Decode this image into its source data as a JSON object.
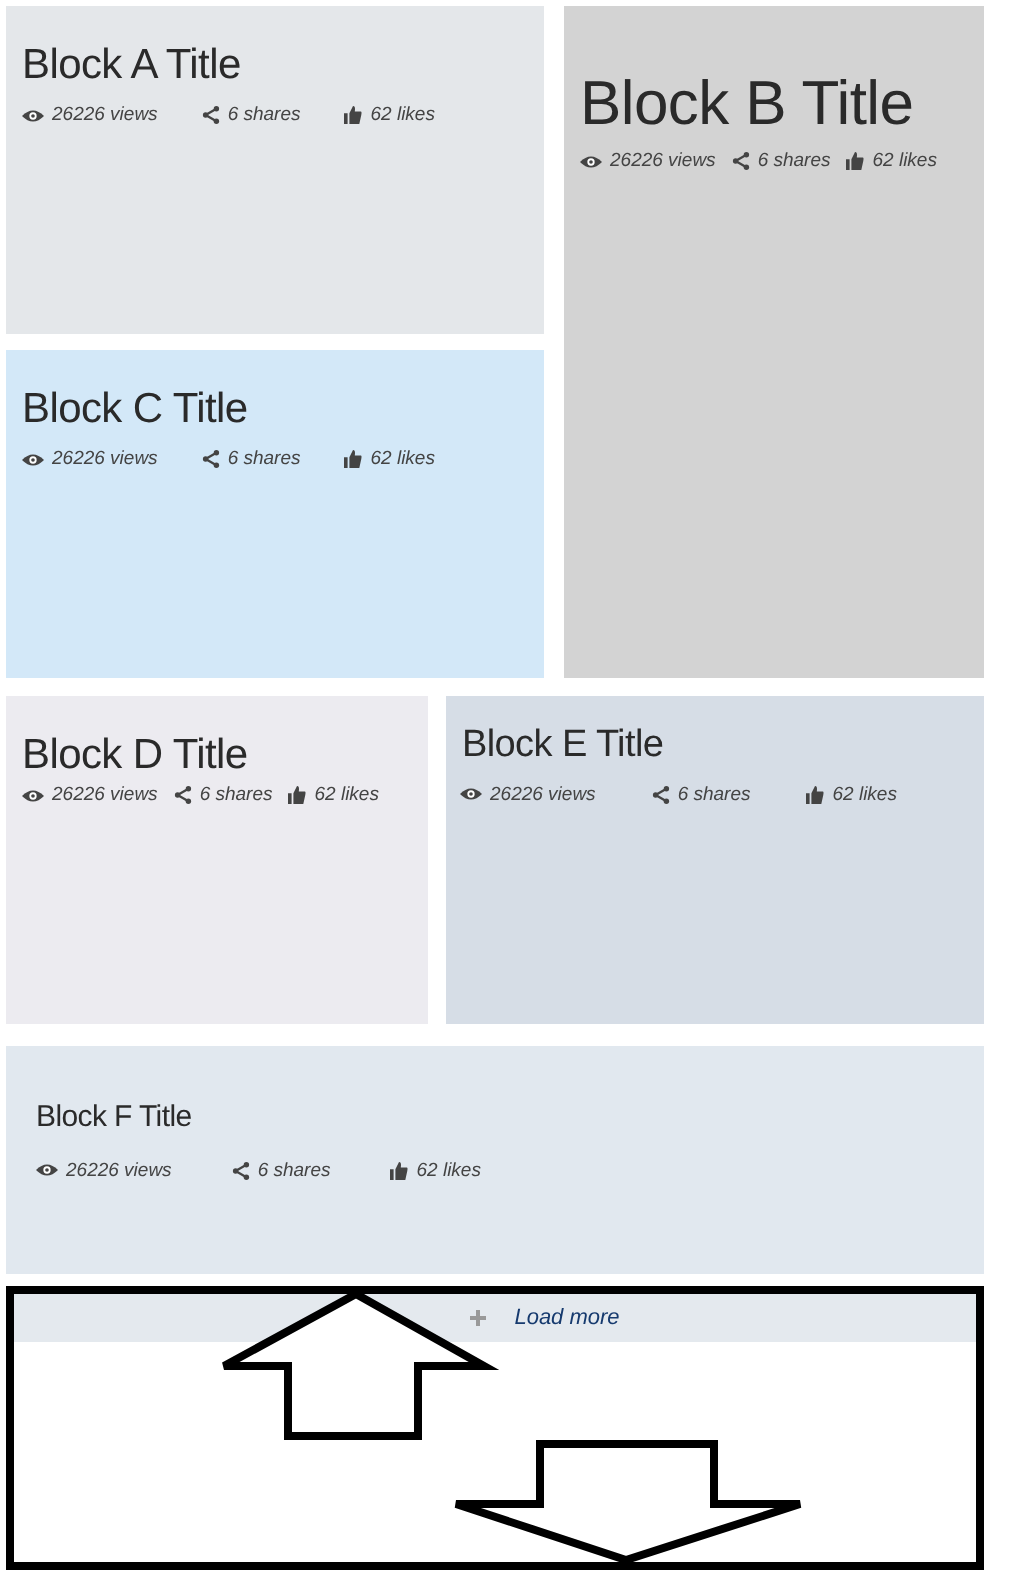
{
  "blocks": [
    {
      "title": "Block A Title",
      "views": "26226 views",
      "shares": "6 shares",
      "likes": "62 likes"
    },
    {
      "title": "Block B Title",
      "views": "26226 views",
      "shares": "6 shares",
      "likes": "62 likes"
    },
    {
      "title": "Block C Title",
      "views": "26226 views",
      "shares": "6 shares",
      "likes": "62 likes"
    },
    {
      "title": "Block D Title",
      "views": "26226 views",
      "shares": "6 shares",
      "likes": "62 likes"
    },
    {
      "title": "Block E Title",
      "views": "26226 views",
      "shares": "6 shares",
      "likes": "62 likes"
    },
    {
      "title": "Block F Title",
      "views": "26226 views",
      "shares": "6 shares",
      "likes": "62 likes"
    }
  ],
  "load_more": {
    "label": "Load more"
  }
}
